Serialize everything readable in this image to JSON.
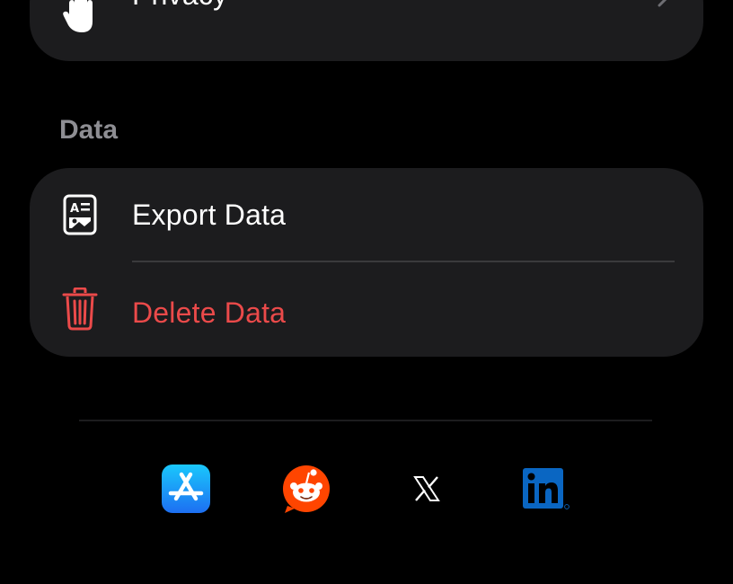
{
  "privacy": {
    "label": "Privacy",
    "icon": "hand-raised-icon"
  },
  "data_section": {
    "header": "Data",
    "items": [
      {
        "label": "Export Data",
        "icon": "export-document-icon",
        "color": "#ffffff"
      },
      {
        "label": "Delete Data",
        "icon": "trash-icon",
        "color": "#eb4a4a"
      }
    ]
  },
  "social_links": [
    {
      "name": "App Store",
      "icon": "app-store-icon",
      "color": "#1d8cf8"
    },
    {
      "name": "Reddit",
      "icon": "reddit-icon",
      "color": "#ff4500"
    },
    {
      "name": "X",
      "icon": "x-icon",
      "color": "#ffffff"
    },
    {
      "name": "LinkedIn",
      "icon": "linkedin-icon",
      "color": "#0a66c2"
    }
  ],
  "colors": {
    "background": "#000000",
    "card": "#1c1c1e",
    "destructive": "#eb4a4a",
    "section_header": "#8e8e93"
  }
}
